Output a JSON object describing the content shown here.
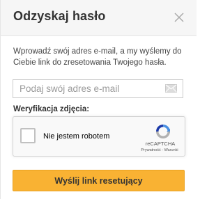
{
  "dialog": {
    "title": "Odzyskaj hasło",
    "close_icon": "close-icon",
    "description": "Wprowadź swój adres e-mail, a my wyślemy do Ciebie link do zresetowania Twojego hasła.",
    "email": {
      "value": "",
      "placeholder": "Podaj swój adres e-mail",
      "icon": "mail-icon"
    },
    "verification_label": "Weryfikacja zdjęcia:",
    "recaptcha": {
      "checkbox_label": "Nie jestem robotem",
      "brand": "reCAPTCHA",
      "privacy_link": "Prywatność",
      "separator": " - ",
      "terms_link": "Warunki",
      "logo_icon": "recaptcha-logo-icon"
    },
    "submit_label": "Wyślij link resetujący"
  },
  "colors": {
    "header_bg": "#f6f6f6",
    "button_bg": "#f9b233",
    "recaptcha_blue": "#4a90e2",
    "recaptcha_gray": "#b2b2b2"
  }
}
